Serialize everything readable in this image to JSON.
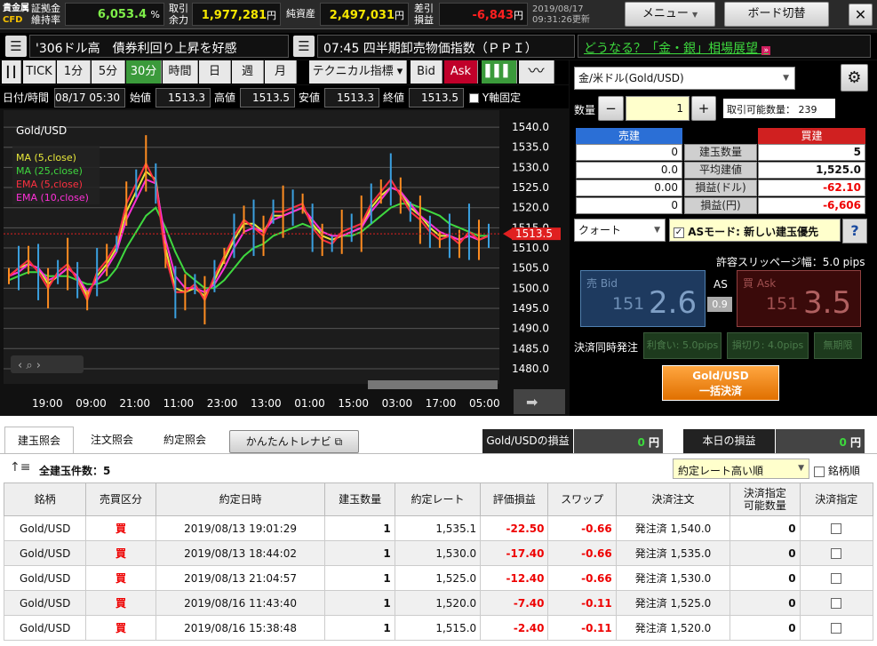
{
  "header": {
    "logo_top": "貴金属",
    "logo_bottom": "CFD",
    "margin_rate_label1": "証拠金",
    "margin_rate_label2": "維持率",
    "margin_rate": "6,053.4",
    "margin_rate_unit": "%",
    "available_label1": "取引",
    "available_label2": "余力",
    "available": "1,977,281",
    "available_unit": "円",
    "net_assets_label": "純資産",
    "net_assets": "2,497,031",
    "net_assets_unit": "円",
    "pl_label1": "差引",
    "pl_label2": "損益",
    "pl": "-6,843",
    "pl_unit": "円",
    "date": "2019/08/17",
    "time": "09:31:26更新",
    "menu_label": "メニュー",
    "board_label": "ボード切替",
    "close_label": "✕"
  },
  "news": {
    "left": "'306ドル高　債券利回り上昇を好感",
    "right": "07:45 四半期卸売物価指数（ＰＰＩ）",
    "link": "どうなる？「金・銀」相場展望"
  },
  "chart_toolbar": {
    "items": [
      "TICK",
      "1分",
      "5分",
      "30分",
      "時間",
      "日",
      "週",
      "月"
    ],
    "selected": "30分",
    "tech": "テクニカル指標",
    "bid": "Bid",
    "ask": "Ask"
  },
  "ohlc": {
    "date_label": "日付/時間",
    "date": "08/17 05:30",
    "open_label": "始値",
    "open": "1513.3",
    "high_label": "高値",
    "high": "1513.5",
    "low_label": "安値",
    "low": "1513.3",
    "close_label": "終値",
    "close": "1513.5",
    "yaxis_label": "Y軸固定"
  },
  "chart_data": {
    "type": "line",
    "symbol": "Gold/USD",
    "legend": [
      {
        "name": "MA (5,close)",
        "color": "#e8e83a"
      },
      {
        "name": "MA (25,close)",
        "color": "#3fd83f"
      },
      {
        "name": "EMA (5,close)",
        "color": "#ff3040"
      },
      {
        "name": "EMA (10,close)",
        "color": "#ff30d8"
      }
    ],
    "ylim": [
      1478,
      1542
    ],
    "yticks": [
      "1540.0",
      "1535.0",
      "1530.0",
      "1525.0",
      "1520.0",
      "1515.0",
      "1510.0",
      "1505.0",
      "1500.0",
      "1495.0",
      "1490.0",
      "1485.0",
      "1480.0"
    ],
    "xticks": [
      "19:00",
      "09:00",
      "21:00",
      "11:00",
      "23:00",
      "13:00",
      "01:00",
      "15:00",
      "03:00",
      "17:00",
      "05:00"
    ],
    "current": "1513.5",
    "series": [
      {
        "name": "MA (5,close)",
        "values": [
          1503,
          1505,
          1506,
          1505,
          1501,
          1503,
          1505,
          1503,
          1498,
          1503,
          1506,
          1510,
          1519,
          1524,
          1529,
          1527,
          1510,
          1500,
          1499,
          1500,
          1498,
          1502,
          1507,
          1512,
          1516,
          1516,
          1514,
          1518,
          1518,
          1519,
          1520,
          1516,
          1513,
          1512,
          1513,
          1514,
          1515,
          1520,
          1523,
          1525,
          1524,
          1520,
          1518,
          1515,
          1513,
          1513,
          1512,
          1513,
          1512,
          1513
        ]
      },
      {
        "name": "MA (25,close)",
        "values": [
          1502,
          1503,
          1504,
          1504,
          1503,
          1503,
          1503,
          1502,
          1501,
          1501,
          1502,
          1505,
          1510,
          1514,
          1518,
          1520,
          1515,
          1509,
          1504,
          1502,
          1500,
          1500,
          1502,
          1505,
          1508,
          1510,
          1511,
          1513,
          1514,
          1515,
          1516,
          1515,
          1514,
          1513,
          1513,
          1513,
          1514,
          1516,
          1518,
          1520,
          1521,
          1521,
          1520,
          1519,
          1518,
          1516,
          1515,
          1514,
          1513,
          1513
        ]
      },
      {
        "name": "EMA (5,close)",
        "values": [
          1503,
          1505,
          1507,
          1504,
          1500,
          1504,
          1506,
          1502,
          1497,
          1504,
          1507,
          1511,
          1521,
          1526,
          1531,
          1526,
          1508,
          1499,
          1499,
          1501,
          1497,
          1503,
          1508,
          1513,
          1517,
          1515,
          1513,
          1519,
          1519,
          1520,
          1521,
          1515,
          1512,
          1511,
          1514,
          1515,
          1516,
          1521,
          1524,
          1527,
          1523,
          1519,
          1517,
          1514,
          1512,
          1513,
          1511,
          1514,
          1512,
          1513
        ]
      },
      {
        "name": "EMA (10,close)",
        "values": [
          1503,
          1504,
          1506,
          1505,
          1502,
          1503,
          1505,
          1503,
          1499,
          1502,
          1505,
          1509,
          1517,
          1522,
          1527,
          1526,
          1512,
          1503,
          1500,
          1500,
          1499,
          1501,
          1505,
          1510,
          1514,
          1515,
          1514,
          1517,
          1518,
          1519,
          1520,
          1517,
          1514,
          1513,
          1513,
          1514,
          1515,
          1519,
          1522,
          1525,
          1524,
          1521,
          1518,
          1516,
          1514,
          1513,
          1512,
          1513,
          1512,
          1513
        ]
      }
    ]
  },
  "order": {
    "symbol": "金/米ドル(Gold/USD)",
    "qty_label": "数量",
    "qty": "1",
    "minus": "−",
    "plus": "+",
    "tradable_label": "取引可能数量：",
    "tradable": "239",
    "sell_label": "売建",
    "buy_label": "買建",
    "rows": [
      {
        "sell": "0",
        "name": "建玉数量",
        "buy": "5"
      },
      {
        "sell": "0.0",
        "name": "平均建値",
        "buy": "1,525.0"
      },
      {
        "sell": "0.00",
        "name": "損益(ドル)",
        "buy": "-62.10"
      },
      {
        "sell": "0",
        "name": "損益(円)",
        "buy": "-6,606"
      }
    ],
    "quote_mode": "クォート",
    "as_mode": "ASモード: 新しい建玉優先",
    "help": "?",
    "slippage": "許容スリッページ幅：5.0 pips",
    "bid_label": "売 Bid",
    "bid_small": "151",
    "bid_big": "2.6",
    "as_label": "AS",
    "as_value": "0.9",
    "ask_label": "買 Ask",
    "ask_small": "151",
    "ask_big": "3.5",
    "settle_label": "決済同時発注",
    "tp": "利食い: 5.0pips",
    "sl": "損切り: 4.0pips",
    "term": "無期限",
    "bulk_line1": "Gold/USD",
    "bulk_line2": "一括決済"
  },
  "bottom": {
    "tabs": [
      "建玉照会",
      "注文照会",
      "約定照会"
    ],
    "navi": "かんたんトレナビ",
    "pl_label": "Gold/USDの損益",
    "pl_value": "0",
    "pl_unit": "円",
    "today_label": "本日の損益",
    "today_value": "0",
    "today_unit": "円",
    "count": "全建玉件数：5",
    "sort": "約定レート高い順",
    "brand_order": "銘柄順",
    "columns": [
      "銘柄",
      "売買区分",
      "約定日時",
      "建玉数量",
      "約定レート",
      "評価損益",
      "スワップ",
      "決済注文",
      "決済指定\n可能数量",
      "決済指定"
    ],
    "rows": [
      [
        "Gold/USD",
        "買",
        "2019/08/13 19:01:29",
        "1",
        "1,535.1",
        "-22.50",
        "-0.66",
        "発注済 1,540.0",
        "0"
      ],
      [
        "Gold/USD",
        "買",
        "2019/08/13 18:44:02",
        "1",
        "1,530.0",
        "-17.40",
        "-0.66",
        "発注済 1,535.0",
        "0"
      ],
      [
        "Gold/USD",
        "買",
        "2019/08/13 21:04:57",
        "1",
        "1,525.0",
        "-12.40",
        "-0.66",
        "発注済 1,530.0",
        "0"
      ],
      [
        "Gold/USD",
        "買",
        "2019/08/16 11:43:40",
        "1",
        "1,520.0",
        "-7.40",
        "-0.11",
        "発注済 1,525.0",
        "0"
      ],
      [
        "Gold/USD",
        "買",
        "2019/08/16 15:38:48",
        "1",
        "1,515.0",
        "-2.40",
        "-0.11",
        "発注済 1,520.0",
        "0"
      ]
    ]
  }
}
